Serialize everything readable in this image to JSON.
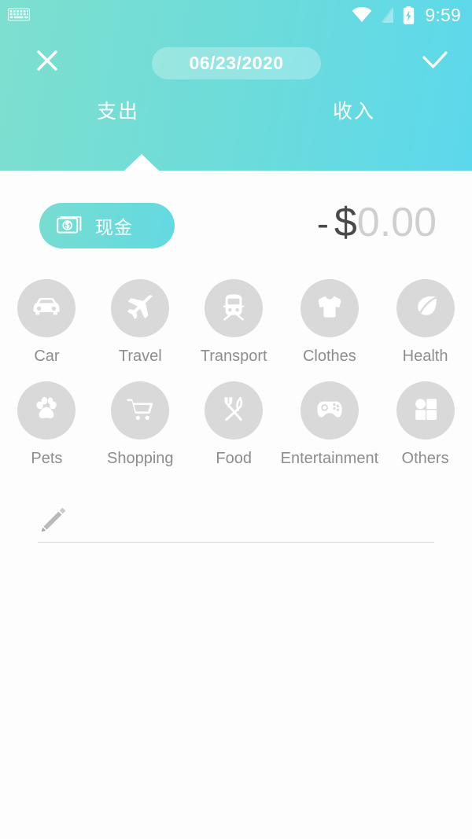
{
  "statusbar": {
    "keyboard_icon": "keyboard-icon",
    "wifi_icon": "wifi-icon",
    "signal_icon": "signal-off-icon",
    "battery_icon": "battery-charging-icon",
    "time": "9:59"
  },
  "header": {
    "close_icon": "close-icon",
    "confirm_icon": "check-icon",
    "date": "06/23/2020",
    "gradient_start": "#7ddfcf",
    "gradient_end": "#5cd8ec",
    "tabs": [
      {
        "label": "支出",
        "name": "tab-expense",
        "active": true
      },
      {
        "label": "收入",
        "name": "tab-income",
        "active": false
      }
    ]
  },
  "account": {
    "icon": "banknote-dollar-icon",
    "label": "现金",
    "pill_color": "#6fdbd9"
  },
  "amount": {
    "sign": "-",
    "currency": "$",
    "value": "0.00",
    "sign_color": "#4a4a4a",
    "value_color": "#cfcfcf"
  },
  "categories": [
    {
      "label": "Car",
      "icon": "car-icon"
    },
    {
      "label": "Travel",
      "icon": "airplane-icon"
    },
    {
      "label": "Transport",
      "icon": "train-icon"
    },
    {
      "label": "Clothes",
      "icon": "tshirt-icon"
    },
    {
      "label": "Health",
      "icon": "leaf-icon"
    },
    {
      "label": "Pets",
      "icon": "paw-icon"
    },
    {
      "label": "Shopping",
      "icon": "shopping-cart-icon"
    },
    {
      "label": "Food",
      "icon": "fork-knife-icon"
    },
    {
      "label": "Entertainment",
      "icon": "game-controller-icon"
    },
    {
      "label": "Others",
      "icon": "grid-shapes-icon"
    }
  ],
  "note": {
    "icon": "pencil-icon",
    "value": "",
    "placeholder": ""
  }
}
